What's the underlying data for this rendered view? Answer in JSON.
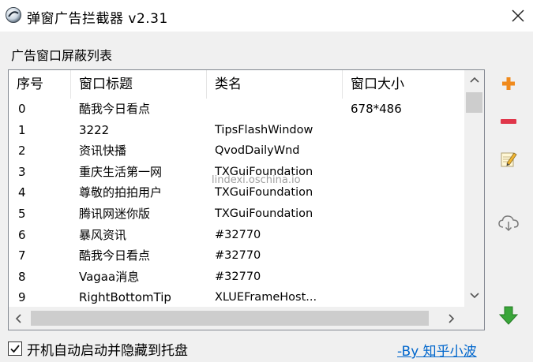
{
  "window": {
    "title": "弹窗广告拦截器 v2.31",
    "close_glyph": "✕"
  },
  "group_label": "广告窗口屏蔽列表",
  "list": {
    "columns": [
      "序号",
      "窗口标题",
      "类名",
      "窗口大小"
    ],
    "rows": [
      {
        "idx": "0",
        "title": "酷我今日看点",
        "class": "",
        "size": "678*486"
      },
      {
        "idx": "1",
        "title": "3222",
        "class": "TipsFlashWindow",
        "size": ""
      },
      {
        "idx": "2",
        "title": "资讯快播",
        "class": "QvodDailyWnd",
        "size": ""
      },
      {
        "idx": "3",
        "title": "重庆生活第一网",
        "class": "TXGuiFoundation",
        "size": ""
      },
      {
        "idx": "4",
        "title": "尊敬的拍拍用户",
        "class": "TXGuiFoundation",
        "size": ""
      },
      {
        "idx": "5",
        "title": "腾讯网迷你版",
        "class": "TXGuiFoundation",
        "size": ""
      },
      {
        "idx": "6",
        "title": "暴风资讯",
        "class": "#32770",
        "size": ""
      },
      {
        "idx": "7",
        "title": "酷我今日看点",
        "class": "#32770",
        "size": ""
      },
      {
        "idx": "8",
        "title": "Vagaa消息",
        "class": "#32770",
        "size": ""
      },
      {
        "idx": "9",
        "title": "RightBottomTip",
        "class": "XLUEFrameHost...",
        "size": ""
      }
    ]
  },
  "watermark": "lindexi.oschina.io",
  "toolbar": {
    "add_icon": "plus-icon",
    "remove_icon": "minus-icon",
    "edit_icon": "pencil-icon",
    "cloud_icon": "cloud-download-icon",
    "download_icon": "green-down-arrow-icon"
  },
  "footer": {
    "checkbox_label": "开机自动启动并隐藏到托盘",
    "checkbox_checked": true,
    "link_text": "-By 知乎小波"
  },
  "colors": {
    "add": "#f08a1c",
    "remove": "#e0364a",
    "download": "#3aa63a",
    "link": "#0066cc"
  }
}
